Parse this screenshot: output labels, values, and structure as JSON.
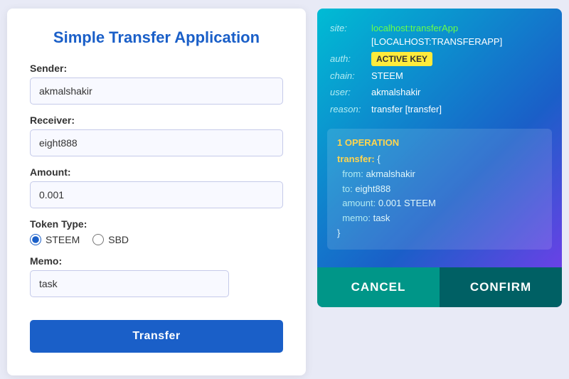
{
  "app": {
    "title": "Simple Transfer Application"
  },
  "form": {
    "sender_label": "Sender:",
    "sender_value": "akmalshakir",
    "receiver_label": "Receiver:",
    "receiver_value": "eight888",
    "amount_label": "Amount:",
    "amount_value": "0.001",
    "token_type_label": "Token Type:",
    "token_steem": "STEEM",
    "token_sbd": "SBD",
    "memo_label": "Memo:",
    "memo_value": "task",
    "transfer_button": "Transfer"
  },
  "auth_panel": {
    "site_label": "site:",
    "site_url_green": "localhost:transferApp",
    "site_url_bracket": "[LOCALHOST:TRANSFERAPP]",
    "auth_label": "auth:",
    "auth_value": "ACTIVE KEY",
    "chain_label": "chain:",
    "chain_value": "STEEM",
    "user_label": "user:",
    "user_value": "akmalshakir",
    "reason_label": "reason:",
    "reason_value": "transfer [transfer]",
    "operation_title": "1 OPERATION",
    "op_key": "transfer:",
    "op_brace_open": "{",
    "op_from_key": "from:",
    "op_from_val": "akmalshakir",
    "op_to_key": "to:",
    "op_to_val": "eight888",
    "op_amount_key": "amount:",
    "op_amount_val": "0.001 STEEM",
    "op_memo_key": "memo:",
    "op_memo_val": "task",
    "op_brace_close": "}",
    "cancel_label": "CANCEL",
    "confirm_label": "CONFIRM"
  }
}
